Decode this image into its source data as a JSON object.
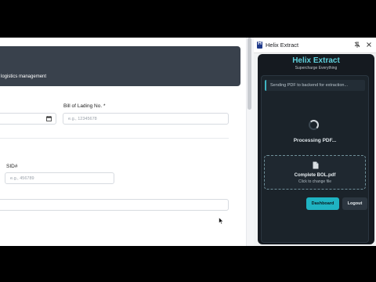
{
  "form": {
    "header_subtitle": "logistics management",
    "bol_label": "Bill of Lading No. *",
    "bol_placeholder": "e.g., 12345678",
    "sid_label": "SID#",
    "sid_placeholder": "e.g., 456789"
  },
  "panel": {
    "title": "Helix Extract",
    "logo_letter": "H"
  },
  "extension": {
    "title": "Helix Extract",
    "tagline": "Supercharge Everything",
    "status_text": "Sending PDF to backend for extraction...",
    "processing_text": "Processing PDF...",
    "file_name": "Complete BOL.pdf",
    "file_hint": "Click to change file",
    "dashboard_label": "Dashboard",
    "logout_label": "Logout"
  },
  "icons": {
    "calendar": "calendar-icon",
    "pin": "pin-icon",
    "close": "close-icon",
    "file": "file-icon",
    "spinner": "loading-spinner",
    "cursor": "mouse-cursor"
  },
  "colors": {
    "accent": "#1fb3c2",
    "brand_title": "#5fd0db",
    "header_bg": "#39414c",
    "panel_bg": "#151a20"
  }
}
